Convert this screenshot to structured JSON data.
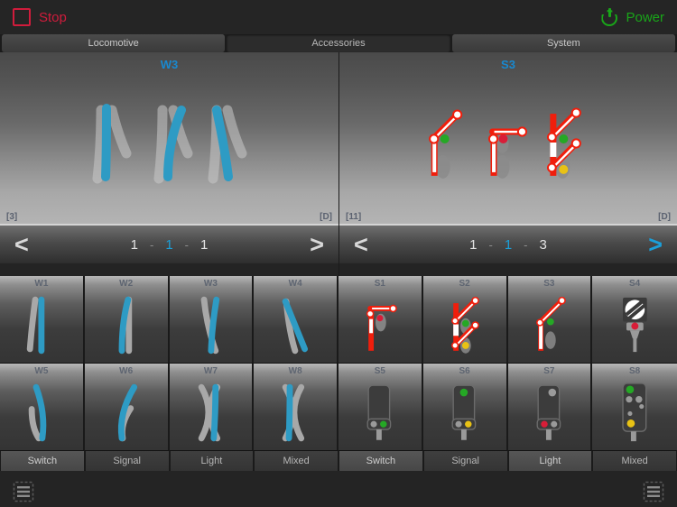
{
  "topbar": {
    "stop_label": "Stop",
    "power_label": "Power",
    "stop_color": "#d01c3c",
    "power_color": "#19a519"
  },
  "tabs": [
    {
      "label": "Locomotive",
      "active": false
    },
    {
      "label": "Accessories",
      "active": true
    },
    {
      "label": "System",
      "active": false
    }
  ],
  "panels": [
    {
      "title": "W3",
      "badge_left": "[3]",
      "badge_right": "[D]",
      "nav": {
        "prev": "<",
        "next": ">",
        "next_accent": false,
        "address": [
          "1",
          "1",
          "1"
        ],
        "address_highlight_index": 1,
        "separator": "-"
      }
    },
    {
      "title": "S3",
      "badge_left": "[11]",
      "badge_right": "[D]",
      "nav": {
        "prev": "<",
        "next": ">",
        "next_accent": true,
        "address": [
          "1",
          "1",
          "3"
        ],
        "address_highlight_index": 1,
        "separator": "-"
      }
    }
  ],
  "grid": {
    "row1": [
      {
        "label": "W1",
        "kind": "switch-straight"
      },
      {
        "label": "W2",
        "kind": "switch-right"
      },
      {
        "label": "W3",
        "kind": "switch-wye"
      },
      {
        "label": "W4",
        "kind": "switch-cross"
      },
      {
        "label": "S1",
        "kind": "semaphore-horizontal"
      },
      {
        "label": "S2",
        "kind": "semaphore-double"
      },
      {
        "label": "S3",
        "kind": "semaphore-diagonal"
      },
      {
        "label": "S4",
        "kind": "disc-signal"
      }
    ],
    "row2": [
      {
        "label": "W5",
        "kind": "switch-curve-right"
      },
      {
        "label": "W6",
        "kind": "switch-curve-left"
      },
      {
        "label": "W7",
        "kind": "switch-double-slip-gray"
      },
      {
        "label": "W8",
        "kind": "switch-double-slip-blue"
      },
      {
        "label": "S5",
        "kind": "light-signal-2"
      },
      {
        "label": "S6",
        "kind": "light-signal-3"
      },
      {
        "label": "S7",
        "kind": "light-signal-red"
      },
      {
        "label": "S8",
        "kind": "light-signal-multi"
      }
    ]
  },
  "categories": [
    {
      "label": "Switch",
      "dim": false
    },
    {
      "label": "Signal",
      "dim": true
    },
    {
      "label": "Light",
      "dim": true
    },
    {
      "label": "Mixed",
      "dim": true
    },
    {
      "label": "Switch",
      "dim": false
    },
    {
      "label": "Signal",
      "dim": true
    },
    {
      "label": "Light",
      "dim": false
    },
    {
      "label": "Mixed",
      "dim": true
    }
  ],
  "bottombar": {
    "left_icon": "grid-view-icon",
    "right_icon": "grid-view-icon"
  },
  "colors": {
    "accent_blue": "#1b9fd8",
    "rail_blue": "#2e9bc4",
    "rail_gray": "#a8a8a8",
    "signal_red": "#f01e0c",
    "signal_green": "#25a825",
    "signal_yellow": "#e8c215"
  }
}
